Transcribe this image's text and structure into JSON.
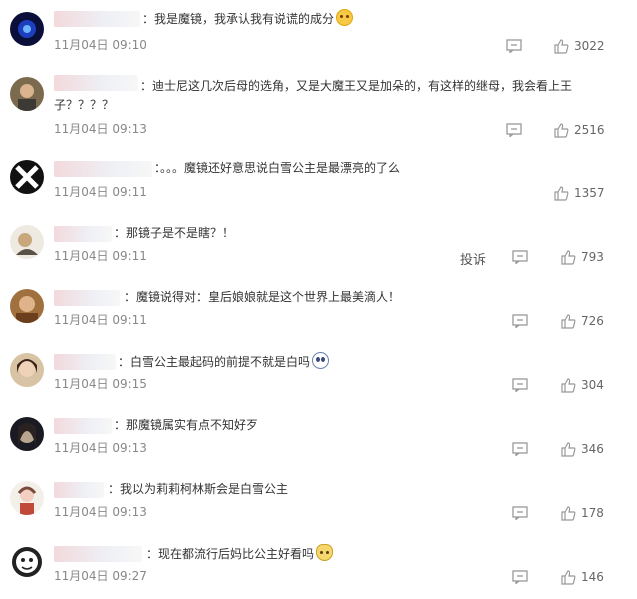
{
  "comments": [
    {
      "text": "：我是魔镜，我承认我有说谎的成分",
      "emoji": "smile-emoji",
      "time": "11月04日 09:10",
      "likes": "3022"
    },
    {
      "text": "：迪士尼这几次后母的选角，又是大魔王又是加朵的，有这样的继母，我会看上王子？？？？",
      "time": "11月04日 09:13",
      "likes": "2516"
    },
    {
      "text": "：。。。魔镜还好意思说白雪公主是最漂亮的了么",
      "time": "11月04日 09:11",
      "likes": "1357"
    },
    {
      "text": "：那镜子是不是瞎？！",
      "time": "11月04日 09:11",
      "likes": "793",
      "report": "投诉"
    },
    {
      "text": "：魔镜说得对：皇后娘娘就是这个世界上最美滴人！",
      "time": "11月04日 09:11",
      "likes": "726"
    },
    {
      "text": "：白雪公主最起码的前提不就是白吗",
      "emoji": "scared-emoji",
      "time": "11月04日 09:15",
      "likes": "304"
    },
    {
      "text": "：那魔镜属实有点不知好歹",
      "time": "11月04日 09:13",
      "likes": "346"
    },
    {
      "text": "：我以为莉莉柯林斯会是白雪公主",
      "time": "11月04日 09:13",
      "likes": "178"
    },
    {
      "text": "：现在都流行后妈比公主好看吗",
      "emoji": "cat-emoji",
      "time": "11月04日 09:27",
      "likes": "146"
    }
  ],
  "icons": {
    "reply": "comment-icon",
    "like": "thumbs-up-icon"
  },
  "colors": {
    "text": "#333333",
    "time": "#888888",
    "icon": "#999999"
  }
}
